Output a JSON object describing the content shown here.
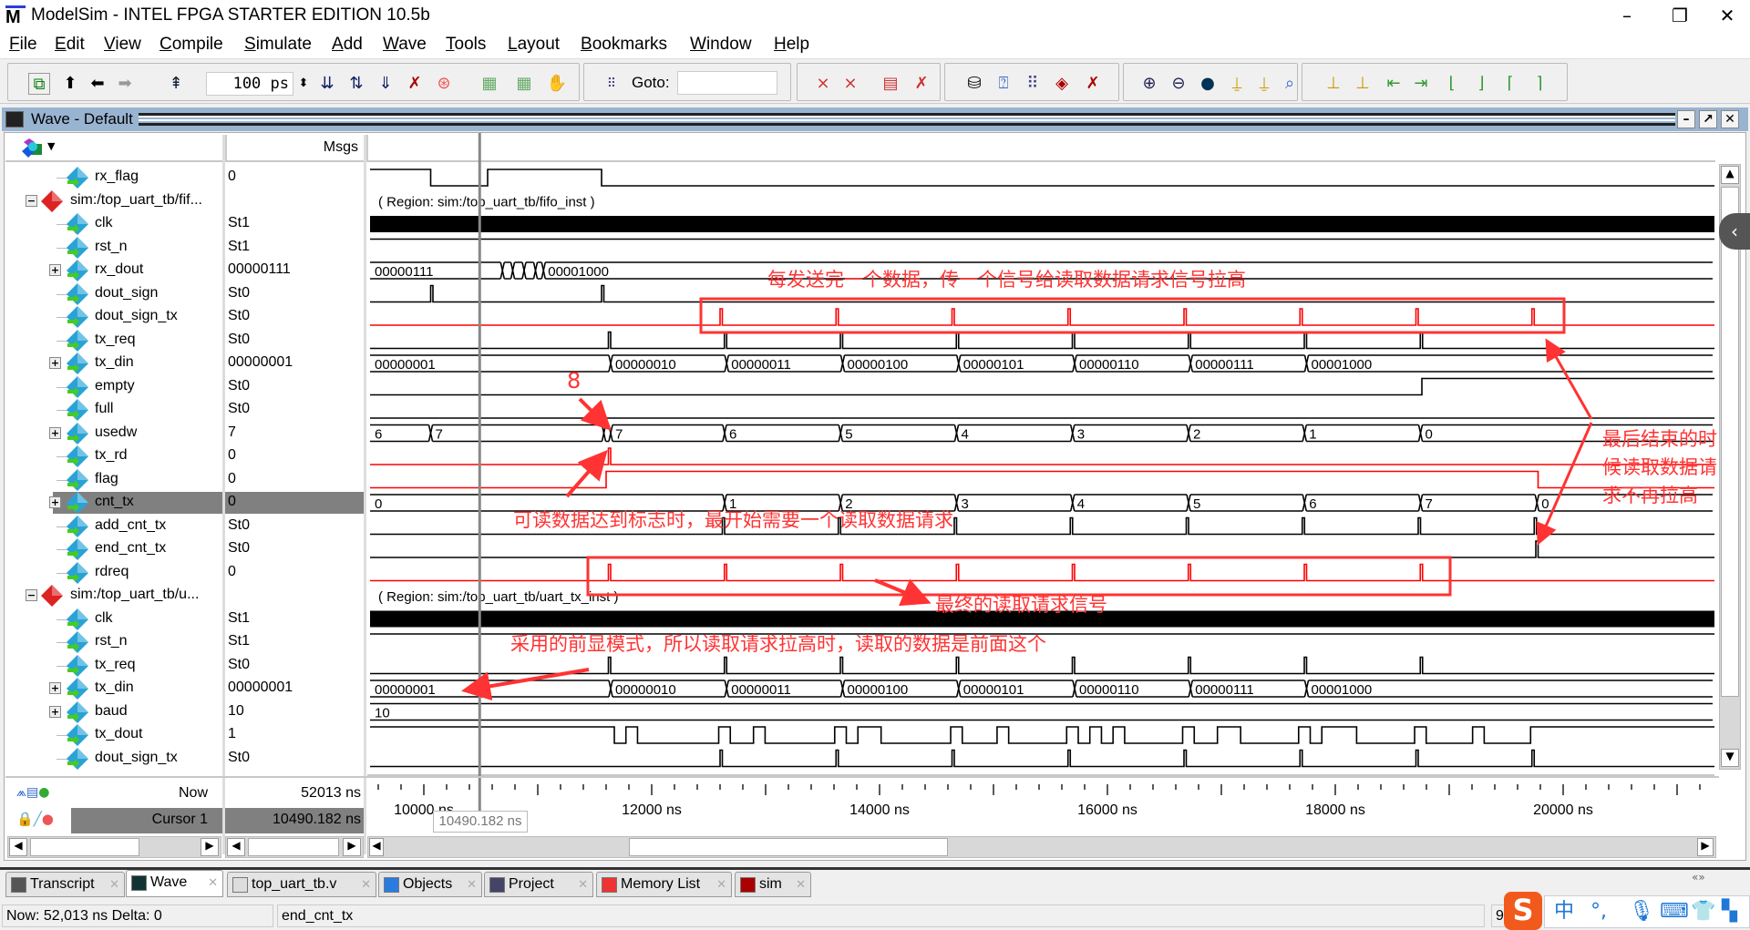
{
  "window": {
    "title": "ModelSim - INTEL FPGA STARTER EDITION 10.5b",
    "logo": "M"
  },
  "menu": [
    "File",
    "Edit",
    "View",
    "Compile",
    "Simulate",
    "Add",
    "Wave",
    "Tools",
    "Layout",
    "Bookmarks",
    "Window",
    "Help"
  ],
  "toolbar": {
    "zoom_value": "100 ps",
    "goto_label": "Goto:",
    "goto_value": ""
  },
  "wave_window": {
    "title": "Wave - Default",
    "msgs_header": "Msgs"
  },
  "signals": [
    {
      "name": "rx_flag",
      "value": "0",
      "kind": "bit",
      "init": 1,
      "edges": [
        10060,
        10560,
        11560
      ]
    },
    {
      "name": "sim:/top_uart_tb/fif...",
      "kind": "group",
      "region": "( Region: sim:/top_uart_tb/fifo_inst )"
    },
    {
      "name": "clk",
      "value": "St1",
      "kind": "clock"
    },
    {
      "name": "rst_n",
      "value": "St1",
      "kind": "bit",
      "init": 1,
      "edges": []
    },
    {
      "name": "rx_dout",
      "value": "00000111",
      "kind": "bus",
      "expandable": true,
      "segments": [
        [
          9520,
          "00000111"
        ],
        [
          10690,
          ""
        ],
        [
          10780,
          ""
        ],
        [
          10880,
          ""
        ],
        [
          10980,
          ""
        ],
        [
          11050,
          "00001000"
        ]
      ]
    },
    {
      "name": "dout_sign",
      "value": "St0",
      "kind": "pulse",
      "pulses": [
        10060,
        11560
      ]
    },
    {
      "name": "dout_sign_tx",
      "value": "St0",
      "kind": "pulse",
      "color": "#ff0000",
      "pulses": [
        12600,
        13618,
        14636,
        15654,
        16672,
        17690,
        18708,
        19726
      ]
    },
    {
      "name": "tx_req",
      "value": "St0",
      "kind": "pulse",
      "pulses": [
        11620,
        12638,
        13656,
        14674,
        15692,
        16710,
        17728,
        18746
      ]
    },
    {
      "name": "tx_din",
      "value": "00000001",
      "kind": "bus",
      "expandable": true,
      "segments": [
        [
          9520,
          "00000001"
        ],
        [
          11640,
          "00000010"
        ],
        [
          12658,
          "00000011"
        ],
        [
          13676,
          "00000100"
        ],
        [
          14694,
          "00000101"
        ],
        [
          15712,
          "00000110"
        ],
        [
          16730,
          "00000111"
        ],
        [
          17748,
          "00001000"
        ]
      ]
    },
    {
      "name": "empty",
      "value": "St0",
      "kind": "bit",
      "init": 0,
      "edges": [
        18760
      ]
    },
    {
      "name": "full",
      "value": "St0",
      "kind": "bit",
      "init": 0,
      "edges": []
    },
    {
      "name": "usedw",
      "value": "7",
      "kind": "bus",
      "expandable": true,
      "segments": [
        [
          9520,
          "6"
        ],
        [
          10060,
          "7"
        ],
        [
          11580,
          ""
        ],
        [
          11640,
          "7"
        ],
        [
          12640,
          "6"
        ],
        [
          13658,
          "5"
        ],
        [
          14676,
          "4"
        ],
        [
          15694,
          "3"
        ],
        [
          16712,
          "2"
        ],
        [
          17730,
          "1"
        ],
        [
          18748,
          "0"
        ]
      ]
    },
    {
      "name": "tx_rd",
      "value": "0",
      "kind": "pulse",
      "color": "#ff0000",
      "pulses": [
        11620
      ]
    },
    {
      "name": "flag",
      "value": "0",
      "kind": "bit",
      "color": "#ff0000",
      "init": 0,
      "edges": [
        11600,
        19780
      ]
    },
    {
      "name": "cnt_tx",
      "value": "0",
      "kind": "bus",
      "expandable": true,
      "selected": true,
      "segments": [
        [
          9520,
          "0"
        ],
        [
          12640,
          "1"
        ],
        [
          13658,
          "2"
        ],
        [
          14676,
          "3"
        ],
        [
          15694,
          "4"
        ],
        [
          16712,
          "5"
        ],
        [
          17730,
          "6"
        ],
        [
          18748,
          "7"
        ],
        [
          19770,
          "0"
        ]
      ]
    },
    {
      "name": "add_cnt_tx",
      "value": "St0",
      "kind": "pulse",
      "pulses": [
        12620,
        13638,
        14656,
        15674,
        16692,
        17710,
        18728,
        19746
      ]
    },
    {
      "name": "end_cnt_tx",
      "value": "St0",
      "kind": "pulse",
      "pulses": [
        19760
      ]
    },
    {
      "name": "rdreq",
      "value": "0",
      "kind": "pulse",
      "color": "#ff0000",
      "pulses": [
        11620,
        12638,
        13656,
        14674,
        15692,
        16710,
        17728,
        18746
      ]
    },
    {
      "name": "sim:/top_uart_tb/u...",
      "kind": "group",
      "region": "( Region: sim:/top_uart_tb/uart_tx_inst )"
    },
    {
      "name": "clk",
      "value": "St1",
      "kind": "clock"
    },
    {
      "name": "rst_n",
      "value": "St1",
      "kind": "bit",
      "init": 1,
      "edges": []
    },
    {
      "name": "tx_req",
      "value": "St0",
      "kind": "pulse",
      "pulses": [
        11620,
        12638,
        13656,
        14674,
        15692,
        16710,
        17728,
        18746
      ]
    },
    {
      "name": "tx_din",
      "value": "00000001",
      "kind": "bus",
      "expandable": true,
      "segments": [
        [
          9520,
          "00000001"
        ],
        [
          11640,
          "00000010"
        ],
        [
          12658,
          "00000011"
        ],
        [
          13676,
          "00000100"
        ],
        [
          14694,
          "00000101"
        ],
        [
          15712,
          "00000110"
        ],
        [
          16730,
          "00000111"
        ],
        [
          17748,
          "00001000"
        ]
      ]
    },
    {
      "name": "baud",
      "value": "10",
      "kind": "bus",
      "expandable": true,
      "segments": [
        [
          9520,
          "10"
        ]
      ]
    },
    {
      "name": "tx_dout",
      "value": "1",
      "kind": "uart",
      "frames": [
        [
          11672,
          "00000001"
        ],
        [
          12690,
          "00000010"
        ],
        [
          13708,
          "00000011"
        ],
        [
          14726,
          "00000100"
        ],
        [
          15744,
          "00000101"
        ],
        [
          16762,
          "00000110"
        ],
        [
          17780,
          "00000111"
        ],
        [
          18798,
          "00001000"
        ]
      ]
    },
    {
      "name": "dout_sign_tx",
      "value": "St0",
      "kind": "pulse",
      "pulses": [
        12600,
        13618,
        14636,
        15654,
        16672,
        17690,
        18708,
        19726
      ]
    }
  ],
  "time_axis": {
    "unit": "ns",
    "labels": [
      "10000 ns",
      "12000 ns",
      "14000 ns",
      "16000 ns",
      "18000 ns",
      "20000 ns"
    ],
    "label_values": [
      10000,
      12000,
      14000,
      16000,
      18000,
      20000
    ],
    "view_range": [
      9520,
      21360
    ],
    "minor_step": 200,
    "major_step": 1000
  },
  "footer": {
    "now_label": "Now",
    "now_value": "52013 ns",
    "cursor_label": "Cursor 1",
    "cursor_value": "10490.182 ns",
    "cursor_time": 10490.182,
    "cursor_tag": "10490.182 ns"
  },
  "annotations": {
    "a1": "每发送完一个数据，传一个信号给读取数据请求信号拉高",
    "a2": "8",
    "a3": "可读数据达到标志时，最开始需要一个读取数据请求",
    "a4": "最终的读取请求信号",
    "a5": "采用的前显模式，所以读取请求拉高时，读取的数据是前面这个",
    "a6": [
      "最后结束的时",
      "候读取数据请",
      "求不再拉高"
    ],
    "color": "#ff3333"
  },
  "tabs": [
    {
      "label": "Transcript",
      "icon": "transcript-icon"
    },
    {
      "label": "Wave",
      "icon": "wave-icon",
      "active": true
    },
    {
      "label": "top_uart_tb.v",
      "icon": "file-icon"
    },
    {
      "label": "Objects",
      "icon": "objects-icon"
    },
    {
      "label": "Project",
      "icon": "project-icon"
    },
    {
      "label": "Memory List",
      "icon": "memory-icon"
    },
    {
      "label": "sim",
      "icon": "sim-icon"
    }
  ],
  "status": {
    "now": "Now: 52,013 ns  Delta: 0",
    "object": "end_cnt_tx",
    "field": "9"
  },
  "ime": {
    "zh": "中",
    "punct": "°,"
  }
}
